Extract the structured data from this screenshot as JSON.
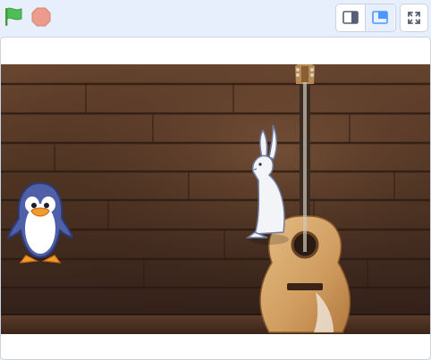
{
  "toolbar": {
    "green_flag": {
      "icon": "green-flag-icon",
      "color": "#4cbf56"
    },
    "stop": {
      "icon": "stop-sign-icon",
      "color": "#ec9c8c"
    },
    "view_modes": [
      {
        "icon": "small-stage-icon",
        "selected": false
      },
      {
        "icon": "large-stage-icon",
        "selected": true
      }
    ],
    "fullscreen": {
      "icon": "fullscreen-icon"
    },
    "accent": "#855cd6",
    "blue": "#4c97ff"
  },
  "stage": {
    "backdrop": "wood-wall-with-guitar",
    "sprites": [
      {
        "name": "penguin",
        "icon": "penguin-sprite"
      },
      {
        "name": "hare",
        "icon": "hare-sprite"
      }
    ]
  }
}
